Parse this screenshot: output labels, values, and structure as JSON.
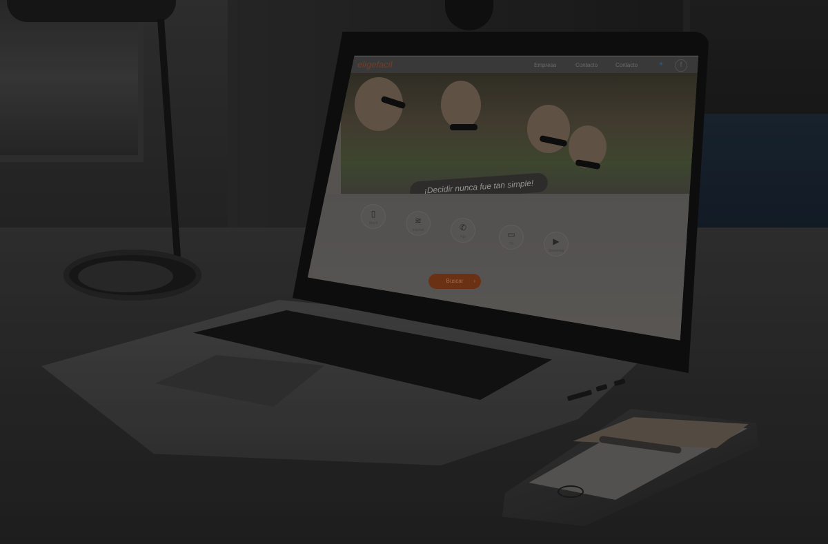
{
  "site": {
    "logo": "eligefacil",
    "nav": [
      "Empresa",
      "Contacto",
      "Contacto"
    ],
    "tagline": "¡Decidir nunca fue tan simple!",
    "categories": [
      {
        "label": "Móvil",
        "icon": "mobile-icon",
        "glyph": "▯"
      },
      {
        "label": "Internet",
        "icon": "wifi-icon",
        "glyph": "≋"
      },
      {
        "label": "Fijo",
        "icon": "phone-icon",
        "glyph": "✆"
      },
      {
        "label": "TV",
        "icon": "tv-icon",
        "glyph": "▭"
      },
      {
        "label": "Streaming",
        "icon": "play-icon",
        "glyph": "▶"
      }
    ],
    "search_label": "Buscar",
    "search_arrow": "›",
    "social": {
      "twitter_glyph": "✦",
      "facebook_glyph": "f"
    }
  },
  "colors": {
    "accent": "#e06a2e",
    "background": "#2a2a2a"
  }
}
